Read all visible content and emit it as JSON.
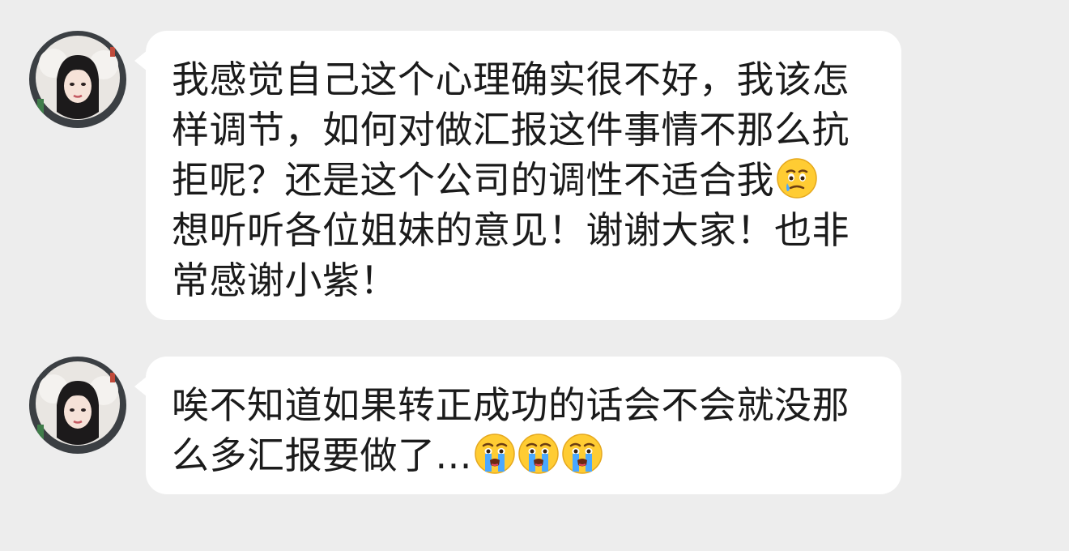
{
  "messages": [
    {
      "sender_avatar": "user-avatar",
      "lines": [
        "我感觉自己这个心理确实很不好，我该怎",
        "样调节，如何对做汇报这件事情不那么抗",
        "拒呢？还是这个公司的调性不适合我",
        "想听听各位姐妹的意见！谢谢大家！也非",
        "常感谢小紫！"
      ],
      "emojis": [
        "holding-back-tears-face-icon"
      ]
    },
    {
      "sender_avatar": "user-avatar",
      "lines": [
        "唉不知道如果转正成功的话会不会就没那",
        "么多汇报要做了..."
      ],
      "emojis": [
        "loudly-crying-face-icon",
        "loudly-crying-face-icon",
        "loudly-crying-face-icon"
      ]
    }
  ],
  "colors": {
    "background": "#ededed",
    "bubble": "#ffffff",
    "text": "#1b1b1b",
    "emoji_yellow": "#ffcc33",
    "emoji_tear": "#4aa8ff"
  }
}
